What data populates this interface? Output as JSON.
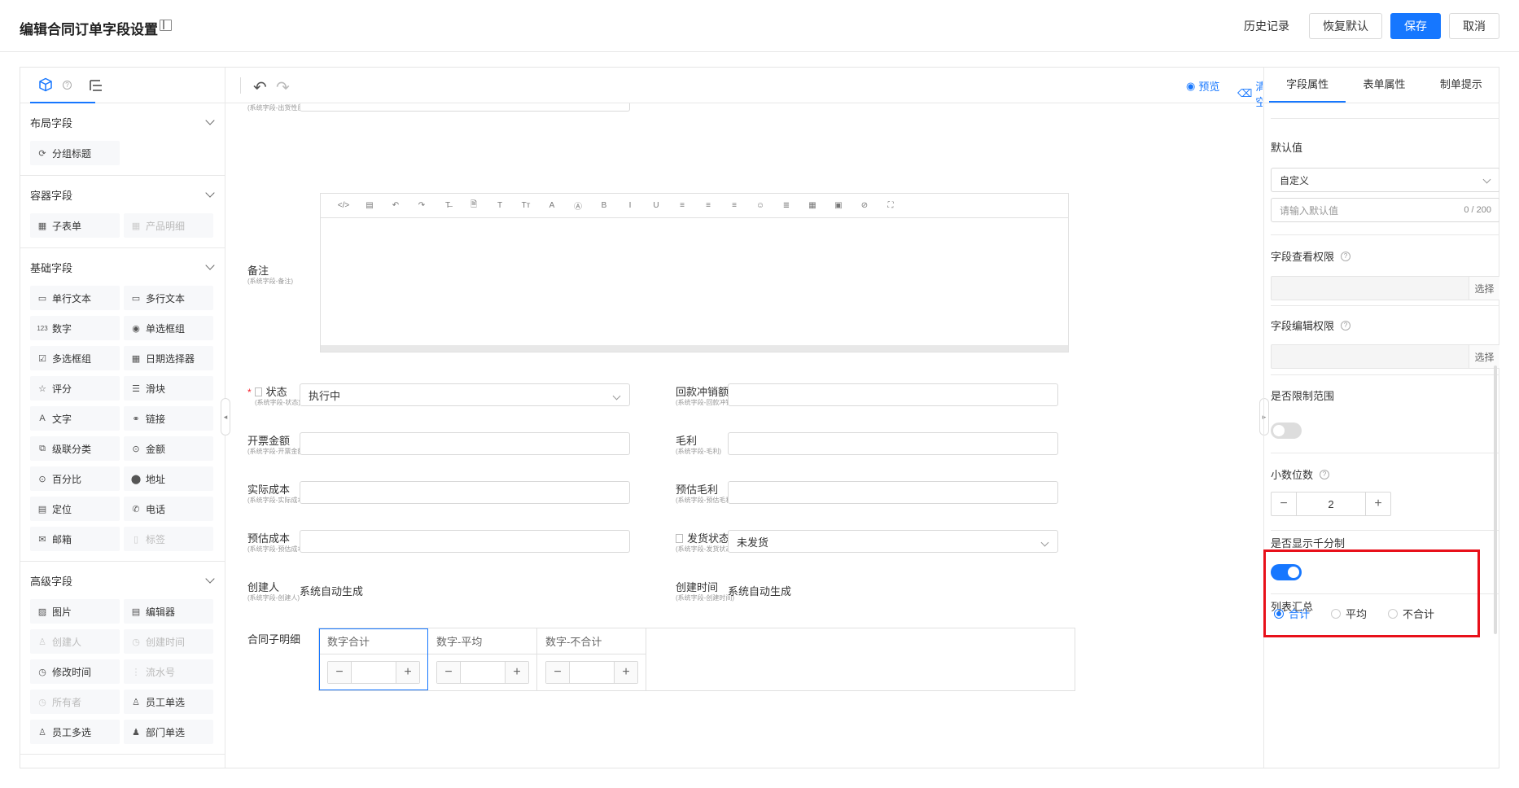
{
  "header": {
    "title": "编辑合同订单字段设置",
    "history": "历史记录",
    "restore": "恢复默认",
    "save": "保存",
    "cancel": "取消"
  },
  "left": {
    "groups": [
      {
        "title": "布局字段",
        "items": [
          {
            "label": "分组标题",
            "icon": "group-title-icon",
            "disabled": false
          }
        ]
      },
      {
        "title": "容器字段",
        "items": [
          {
            "label": "子表单",
            "icon": "table-icon",
            "disabled": false
          },
          {
            "label": "产品明细",
            "icon": "table-icon",
            "disabled": true
          }
        ]
      },
      {
        "title": "基础字段",
        "items": [
          {
            "label": "单行文本",
            "icon": "single-line-icon",
            "disabled": false
          },
          {
            "label": "多行文本",
            "icon": "multi-line-icon",
            "disabled": false
          },
          {
            "label": "数字",
            "icon": "number-icon",
            "disabled": false
          },
          {
            "label": "单选框组",
            "icon": "radio-icon",
            "disabled": false
          },
          {
            "label": "多选框组",
            "icon": "checkbox-icon",
            "disabled": false
          },
          {
            "label": "日期选择器",
            "icon": "calendar-icon",
            "disabled": false
          },
          {
            "label": "评分",
            "icon": "star-icon",
            "disabled": false
          },
          {
            "label": "滑块",
            "icon": "slider-icon",
            "disabled": false
          },
          {
            "label": "文字",
            "icon": "text-icon",
            "disabled": false
          },
          {
            "label": "链接",
            "icon": "link-icon",
            "disabled": false
          },
          {
            "label": "级联分类",
            "icon": "cascade-icon",
            "disabled": false
          },
          {
            "label": "金额",
            "icon": "amount-icon",
            "disabled": false
          },
          {
            "label": "百分比",
            "icon": "percent-icon",
            "disabled": false
          },
          {
            "label": "地址",
            "icon": "location-pin-icon",
            "disabled": false
          },
          {
            "label": "定位",
            "icon": "locate-icon",
            "disabled": false
          },
          {
            "label": "电话",
            "icon": "phone-icon",
            "disabled": false
          },
          {
            "label": "邮箱",
            "icon": "mail-icon",
            "disabled": false
          },
          {
            "label": "标签",
            "icon": "tag-icon",
            "disabled": true
          }
        ]
      },
      {
        "title": "高级字段",
        "items": [
          {
            "label": "图片",
            "icon": "image-icon",
            "disabled": false
          },
          {
            "label": "编辑器",
            "icon": "editor-icon",
            "disabled": false
          },
          {
            "label": "创建人",
            "icon": "user-icon",
            "disabled": true
          },
          {
            "label": "创建时间",
            "icon": "clock-icon",
            "disabled": true
          },
          {
            "label": "修改时间",
            "icon": "clock-icon",
            "disabled": false
          },
          {
            "label": "流水号",
            "icon": "serial-icon",
            "disabled": true
          },
          {
            "label": "所有者",
            "icon": "owner-icon",
            "disabled": true
          },
          {
            "label": "员工单选",
            "icon": "user-icon",
            "disabled": false
          },
          {
            "label": "员工多选",
            "icon": "users-icon",
            "disabled": false
          },
          {
            "label": "部门单选",
            "icon": "department-icon",
            "disabled": false
          }
        ]
      }
    ]
  },
  "center": {
    "preview": "预览",
    "clear": "清空",
    "top_sub": "(系统字段-出货性质)",
    "remark": {
      "label": "备注",
      "sub": "(系统字段-备注)"
    },
    "editor_tools": [
      "</>",
      "▤",
      "↶",
      "↷",
      "T̶",
      "🗎",
      "T",
      "Tт",
      "A",
      "Ⓐ",
      "B",
      "I",
      "U",
      "≡",
      "≡",
      "≡",
      "☺",
      "≣",
      "▦",
      "▣",
      "⊘",
      "⛶"
    ],
    "status": {
      "label": "状态",
      "sub": "(系统字段-状态)",
      "value": "执行中"
    },
    "refund": {
      "label": "回款冲销额",
      "sub": "(系统字段-回款冲销额)",
      "value": ""
    },
    "invoice": {
      "label": "开票金额",
      "sub": "(系统字段-开票金额)",
      "value": ""
    },
    "gross": {
      "label": "毛利",
      "sub": "(系统字段-毛利)",
      "value": ""
    },
    "actual_cost": {
      "label": "实际成本",
      "sub": "(系统字段-实际成本)",
      "value": ""
    },
    "est_gross": {
      "label": "预估毛利",
      "sub": "(系统字段-预估毛利)",
      "value": ""
    },
    "est_cost": {
      "label": "预估成本",
      "sub": "(系统字段-预估成本)",
      "value": ""
    },
    "ship": {
      "label": "发货状态",
      "sub": "(系统字段-发货状态)",
      "value": "未发货"
    },
    "creator": {
      "label": "创建人",
      "sub": "(系统字段-创建人)",
      "value": "系统自动生成"
    },
    "created_at": {
      "label": "创建时间",
      "sub": "(系统字段-创建时间)",
      "value": "系统自动生成"
    },
    "subtable": {
      "label": "合同子明细",
      "columns": [
        "数字合计",
        "数字-平均",
        "数字-不合计"
      ]
    }
  },
  "right": {
    "tabs": [
      "字段属性",
      "表单属性",
      "制单提示"
    ],
    "default_label": "默认值",
    "default_mode": "自定义",
    "default_placeholder": "请输入默认值",
    "default_count": "0 / 200",
    "view_perm": "字段查看权限",
    "edit_perm": "字段编辑权限",
    "choose": "选择",
    "limit_range": "是否限制范围",
    "decimals_label": "小数位数",
    "decimals_value": "2",
    "thousands": "是否显示千分制",
    "summary_label": "列表汇总",
    "summary_options": [
      "合计",
      "平均",
      "不合计"
    ],
    "summary_selected": 0,
    "limit_range_on": false,
    "thousands_on": true
  },
  "colors": {
    "primary": "#1677ff",
    "highlight": "#e8101a"
  }
}
